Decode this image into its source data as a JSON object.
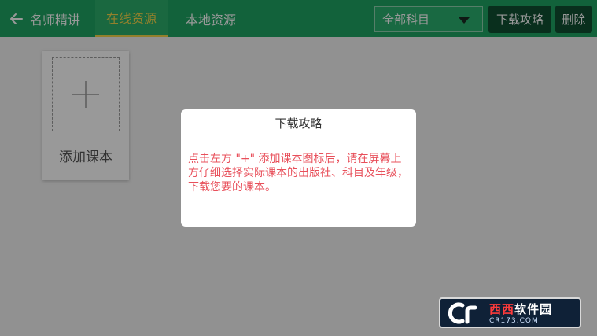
{
  "header": {
    "back_label": "名师精讲",
    "tabs": [
      {
        "label": "在线资源",
        "active": true
      },
      {
        "label": "本地资源",
        "active": false
      }
    ],
    "subject_select": {
      "value": "全部科目"
    },
    "download_guide_label": "下载攻略",
    "delete_label": "删除"
  },
  "content": {
    "add_book_label": "添加课本"
  },
  "dialog": {
    "title": "下载攻略",
    "message": "点击左方 \"+\" 添加课本图标后，请在屏幕上方仔细选择实际课本的出版社、科目及年级，下载您要的课本。"
  },
  "watermark": {
    "brand_red": "西西",
    "brand_white": "软件园",
    "url": "CR173.COM"
  },
  "colors": {
    "header_green": "#1fa463",
    "active_tab": "#f5d64a",
    "dark_button": "#0f4f31",
    "message_red": "#e8505b"
  }
}
